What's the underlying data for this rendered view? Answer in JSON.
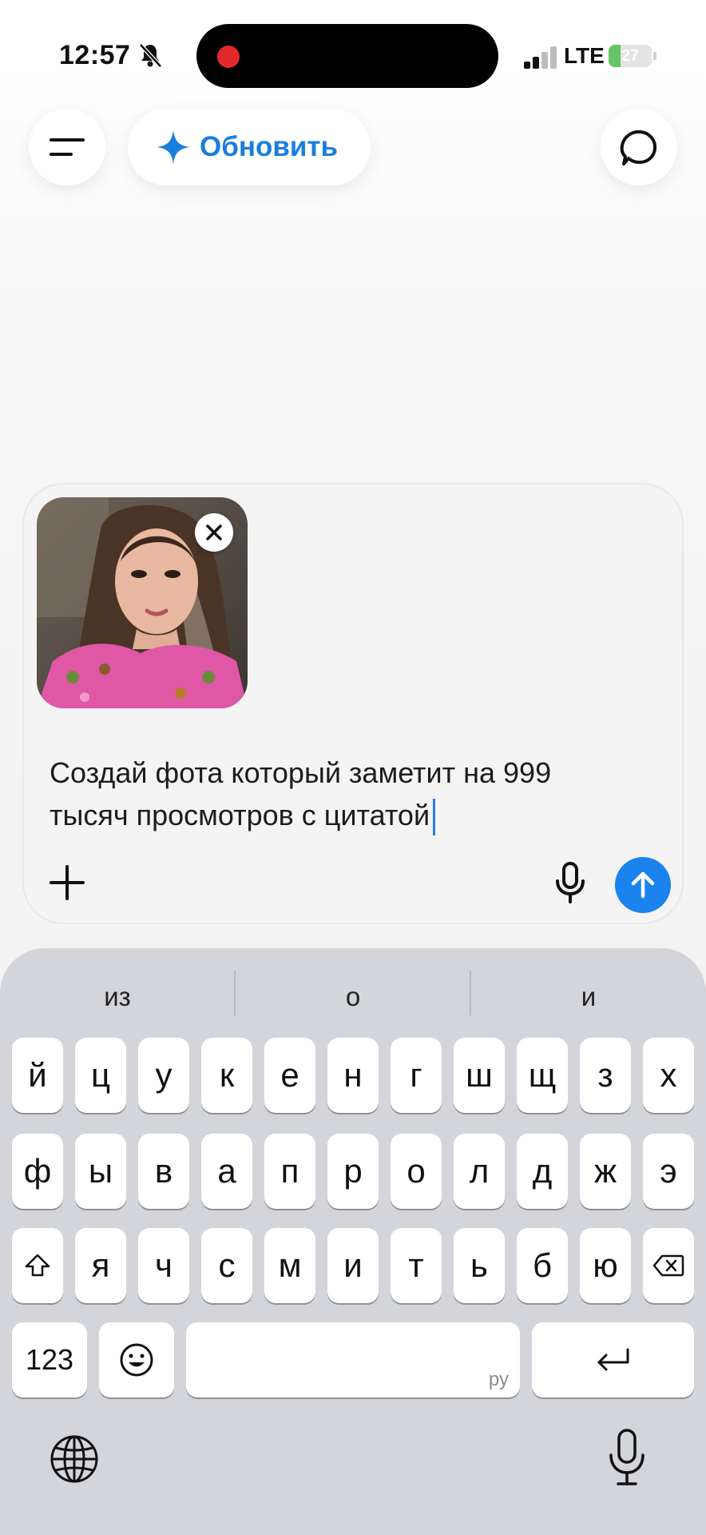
{
  "status_bar": {
    "time": "12:57",
    "network": "LTE",
    "battery": "27",
    "battery_level": 0.27,
    "bell_icon": "bell-slash-icon"
  },
  "header": {
    "menu_icon": "menu-icon",
    "upgrade_label": "Обновить",
    "upgrade_icon": "sparkle-icon",
    "new_chat_icon": "chat-bubble-icon",
    "accent_color": "#1a7de0"
  },
  "composer": {
    "attachment_icon": "photo-thumbnail",
    "remove_icon": "close-icon",
    "prompt_line1": "Создай фота который заметит на 999",
    "prompt_line2": "тысяч просмотров с цитатой",
    "add_icon": "plus-icon",
    "mic_icon": "microphone-icon",
    "send_icon": "arrow-up-icon",
    "send_color": "#1a83ee"
  },
  "keyboard": {
    "suggestions": [
      "из",
      "о",
      "и"
    ],
    "row1": [
      "й",
      "ц",
      "у",
      "к",
      "е",
      "н",
      "г",
      "ш",
      "щ",
      "з",
      "х"
    ],
    "row2": [
      "ф",
      "ы",
      "в",
      "а",
      "п",
      "р",
      "о",
      "л",
      "д",
      "ж",
      "э"
    ],
    "row3": [
      "я",
      "ч",
      "с",
      "м",
      "и",
      "т",
      "ь",
      "б",
      "ю"
    ],
    "numbers_key": "123",
    "space_lang": "ру",
    "shift_icon": "shift-icon",
    "delete_icon": "delete-icon",
    "emoji_icon": "emoji-icon",
    "return_icon": "return-icon",
    "globe_icon": "globe-icon",
    "dictation_icon": "microphone-icon"
  }
}
